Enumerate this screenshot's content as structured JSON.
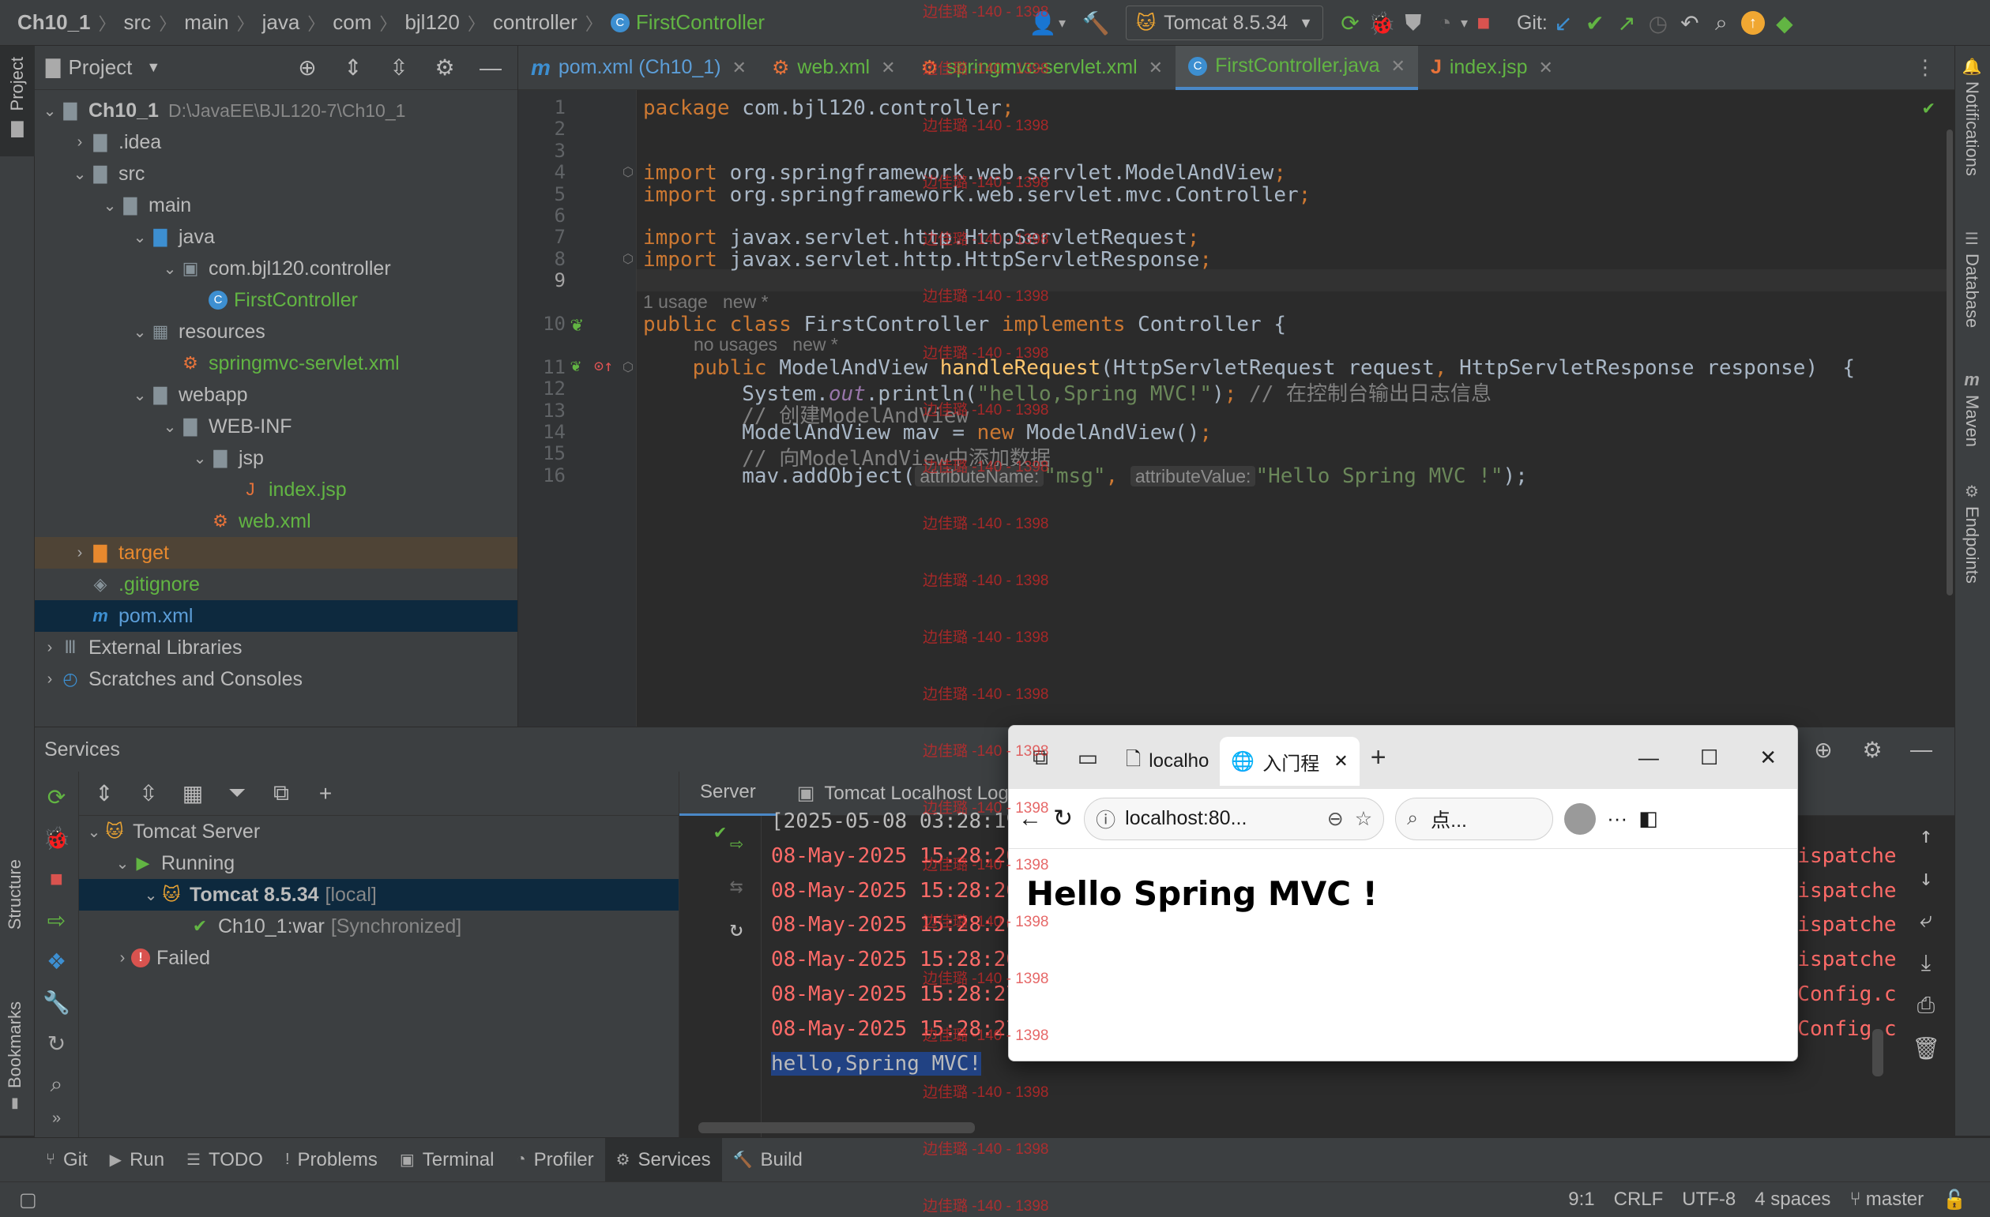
{
  "navbar": {
    "breadcrumbs": [
      "Ch10_1",
      "src",
      "main",
      "java",
      "com",
      "bjl120",
      "controller",
      "FirstController"
    ],
    "run_config": "Tomcat 8.5.34",
    "git_label": "Git:"
  },
  "left_strip": {
    "project": "Project",
    "structure": "Structure",
    "bookmarks": "Bookmarks"
  },
  "right_strip": {
    "notifications": "Notifications",
    "database": "Database",
    "maven": "Maven",
    "endpoints": "Endpoints"
  },
  "project_panel": {
    "title": "Project",
    "tree": [
      {
        "depth": 0,
        "arrow": "v",
        "icon": "module",
        "label": "Ch10_1",
        "extra": "D:\\JavaEE\\BJL120-7\\Ch10_1",
        "bold": true
      },
      {
        "depth": 1,
        "arrow": ">",
        "icon": "folder",
        "label": ".idea"
      },
      {
        "depth": 1,
        "arrow": "v",
        "icon": "folder",
        "label": "src"
      },
      {
        "depth": 2,
        "arrow": "v",
        "icon": "folder",
        "label": "main"
      },
      {
        "depth": 3,
        "arrow": "v",
        "icon": "folder-blue",
        "label": "java"
      },
      {
        "depth": 4,
        "arrow": "v",
        "icon": "package",
        "label": "com.bjl120.controller"
      },
      {
        "depth": 5,
        "arrow": "",
        "icon": "class",
        "label": "FirstController",
        "color": "green"
      },
      {
        "depth": 3,
        "arrow": "v",
        "icon": "resources",
        "label": "resources"
      },
      {
        "depth": 4,
        "arrow": "",
        "icon": "xml",
        "label": "springmvc-servlet.xml",
        "color": "green"
      },
      {
        "depth": 3,
        "arrow": "v",
        "icon": "web",
        "label": "webapp"
      },
      {
        "depth": 4,
        "arrow": "v",
        "icon": "folder",
        "label": "WEB-INF"
      },
      {
        "depth": 5,
        "arrow": "v",
        "icon": "folder",
        "label": "jsp"
      },
      {
        "depth": 6,
        "arrow": "",
        "icon": "jsp",
        "label": "index.jsp",
        "color": "green"
      },
      {
        "depth": 5,
        "arrow": "",
        "icon": "xml",
        "label": "web.xml",
        "color": "green"
      },
      {
        "depth": 1,
        "arrow": ">",
        "icon": "folder-orange",
        "label": "target",
        "color": "orange",
        "sel": "amber"
      },
      {
        "depth": 1,
        "arrow": "",
        "icon": "git",
        "label": ".gitignore",
        "color": "green"
      },
      {
        "depth": 1,
        "arrow": "",
        "icon": "maven",
        "label": "pom.xml",
        "color": "blue",
        "sel": "dark"
      },
      {
        "depth": 0,
        "arrow": ">",
        "icon": "lib",
        "label": "External Libraries"
      },
      {
        "depth": 0,
        "arrow": ">",
        "icon": "scratch",
        "label": "Scratches and Consoles"
      }
    ]
  },
  "editor_tabs": [
    {
      "icon": "m",
      "label": "pom.xml (Ch10_1)",
      "color": "blue"
    },
    {
      "icon": "xml",
      "label": "web.xml",
      "color": "green"
    },
    {
      "icon": "xml",
      "label": "springmvc-servlet.xml",
      "color": "green"
    },
    {
      "icon": "class",
      "label": "FirstController.java",
      "color": "green",
      "active": true
    },
    {
      "icon": "jsp",
      "label": "index.jsp",
      "color": "green"
    }
  ],
  "editor": {
    "hints": {
      "usage": "1 usage   new *",
      "no_usages": "no usages   new *",
      "param1": "attributeName:",
      "param2": "attributeValue:"
    },
    "lines": [
      {
        "n": "1",
        "html": "<span class='kw'>package</span> com.bjl120.controller<span class='kw'>;</span>"
      },
      {
        "n": "2",
        "html": ""
      },
      {
        "n": "3",
        "html": ""
      },
      {
        "n": "4",
        "html": "<span class='kw'>import</span> org.springframework.web.servlet.ModelAndView<span class='kw'>;</span>"
      },
      {
        "n": "5",
        "html": "<span class='kw'>import</span> org.springframework.web.servlet.mvc.Controller<span class='kw'>;</span>"
      },
      {
        "n": "6",
        "html": ""
      },
      {
        "n": "7",
        "html": "<span class='kw'>import</span> javax.servlet.http.HttpServletRequest<span class='kw'>;</span>"
      },
      {
        "n": "8",
        "html": "<span class='kw'>import</span> javax.servlet.http.HttpServletResponse<span class='kw'>;</span>"
      },
      {
        "n": "9",
        "html": ""
      },
      {
        "n": "10",
        "html": "<span class='kw'>public class</span> FirstController <span class='kw'>implements</span> Controller {"
      },
      {
        "n": "11",
        "html": "    <span class='kw'>public</span> ModelAndView <span class='fn'>handleRequest</span>(HttpServletRequest request<span class='kw'>,</span> HttpServletResponse response)  {"
      },
      {
        "n": "12",
        "html": "        System.<span class='it'>out</span>.println(<span class='str'>\"hello,Spring MVC!\"</span>)<span class='kw'>;</span> <span class='cm'>// 在控制台输出日志信息</span>"
      },
      {
        "n": "13",
        "html": "        <span class='cm'>// 创建ModelAndView</span>"
      },
      {
        "n": "14",
        "html": "        ModelAndView mav = <span class='kw'>new</span> ModelAndView()<span class='kw'>;</span>"
      },
      {
        "n": "15",
        "html": "        <span class='cm'>// 向ModelAndView中添加数据</span>"
      }
    ],
    "line16": {
      "n": "16",
      "prefix": "        mav.addObject(",
      "arg1": "\"msg\"",
      "sep": ", ",
      "arg2": "\"Hello Spring MVC !\"",
      "suffix": ");"
    }
  },
  "services": {
    "title": "Services",
    "tree": [
      {
        "depth": 0,
        "arrow": "v",
        "icon": "tomcat",
        "label": "Tomcat Server"
      },
      {
        "depth": 1,
        "arrow": "v",
        "icon": "run",
        "label": "Running"
      },
      {
        "depth": 2,
        "arrow": "v",
        "icon": "tomcat",
        "label": "Tomcat 8.5.34",
        "extra": "[local]",
        "bold": true,
        "sel": true
      },
      {
        "depth": 3,
        "arrow": "",
        "icon": "artifact",
        "label": "Ch10_1:war",
        "extra": "[Synchronized]"
      },
      {
        "depth": 1,
        "arrow": ">",
        "icon": "fail",
        "label": "Failed"
      }
    ],
    "console_tabs": [
      "Server",
      "Tomcat Localhost Log"
    ],
    "log": [
      "[2025-05-08 03:28:19,",
      "08-May-2025 15:28:20.",
      "08-May-2025 15:28:20.",
      "08-May-2025 15:28:20.",
      "08-May-2025 15:28:20.",
      "08-May-2025 15:28:27.",
      "08-May-2025 15:28:27."
    ],
    "log_tail": [
      ".Dispatche",
      ".Dispatche",
      ".Dispatche",
      ".Dispatche",
      "stConfig.c",
      "stConfig.c"
    ],
    "output": "hello,Spring MVC!"
  },
  "toolbar_bottom": [
    "Git",
    "Run",
    "TODO",
    "Problems",
    "Terminal",
    "Profiler",
    "Services",
    "Build"
  ],
  "status": {
    "position": "9:1",
    "line_sep": "CRLF",
    "encoding": "UTF-8",
    "indent": "4 spaces",
    "branch": "master"
  },
  "browser": {
    "tab1": "localho",
    "tab2": "入门程",
    "url": "localhost:80...",
    "search_placeholder": "点...",
    "heading": "Hello Spring MVC !"
  },
  "watermark": "边佳璐 -140 - 1398"
}
